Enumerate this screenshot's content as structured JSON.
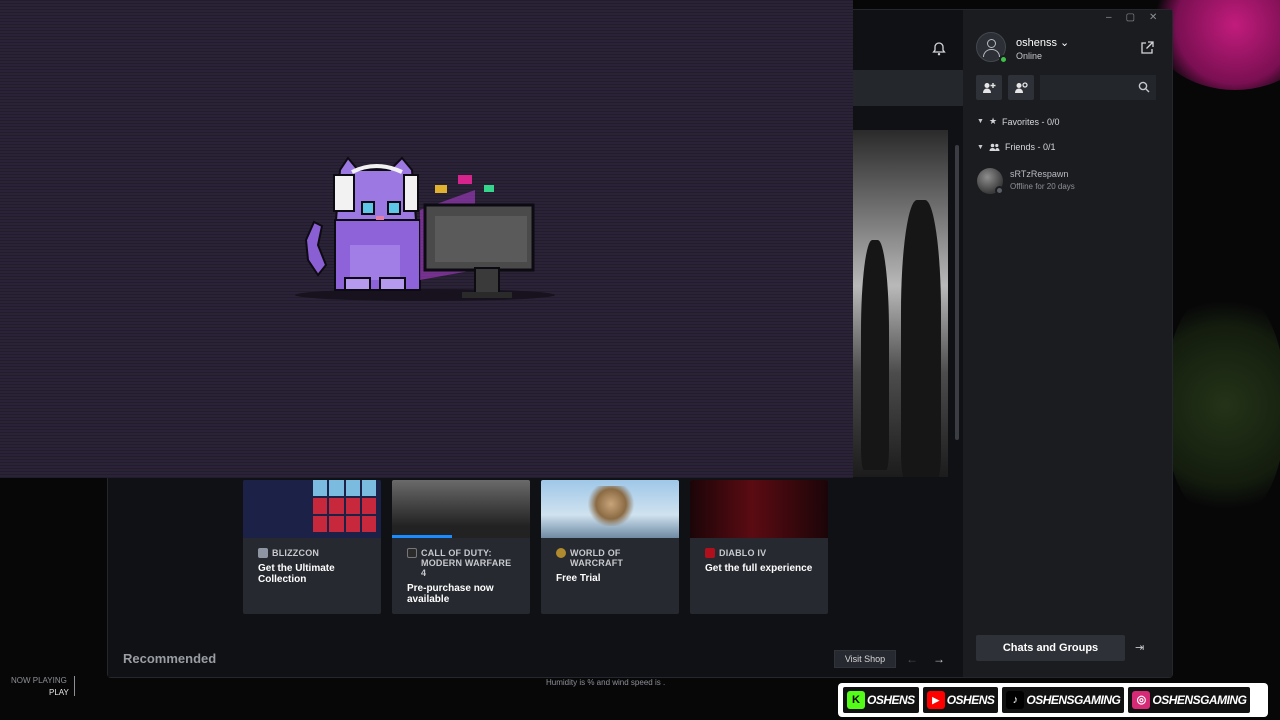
{
  "window_controls": [
    "–",
    "▢",
    "✕"
  ],
  "profile": {
    "username": "oshenss",
    "username_caret": "⌄",
    "status": "Online"
  },
  "friends_panel": {
    "favorites_label": "Favorites - 0/0",
    "friends_label": "Friends - 0/1",
    "friends": [
      {
        "name": "sRTzRespawn",
        "status": "Offline for 20 days"
      }
    ],
    "chats_button": "Chats and Groups"
  },
  "shop_cards": [
    {
      "brand": "BLIZZCON",
      "title": "Get the Ultimate Collection",
      "icon_color": "#8e96a3"
    },
    {
      "brand": "CALL OF DUTY: MODERN WARFARE 4",
      "title": "Pre-purchase now available",
      "icon_color": "#2b2b2b"
    },
    {
      "brand": "WORLD OF WARCRAFT",
      "title": "Free Trial",
      "icon_color": "#b08a2e"
    },
    {
      "brand": "DIABLO IV",
      "title": "Get the full experience",
      "icon_color": "#b0101c"
    }
  ],
  "recommended_label": "Recommended",
  "visit_shop_label": "Visit Shop",
  "nav_arrows": {
    "prev": "←",
    "next": "→"
  },
  "stream_overlay": {
    "now_playing_label": "NOW PLAYING",
    "play_label": "PLAY",
    "weather_text": "Humidity is  % and wind speed is  .",
    "socials": [
      {
        "platform": "kick",
        "glyph": "K",
        "handle": "OSHENS",
        "color": "#53fc18"
      },
      {
        "platform": "youtube",
        "glyph": "▶",
        "handle": "OSHENS",
        "color": "#ff0000"
      },
      {
        "platform": "tiktok",
        "glyph": "♪",
        "handle": "OSHENSGAMING",
        "color": "#000000"
      },
      {
        "platform": "instagram",
        "glyph": "◎",
        "handle": "OSHENSGAMING",
        "color": "#d62976"
      }
    ]
  }
}
